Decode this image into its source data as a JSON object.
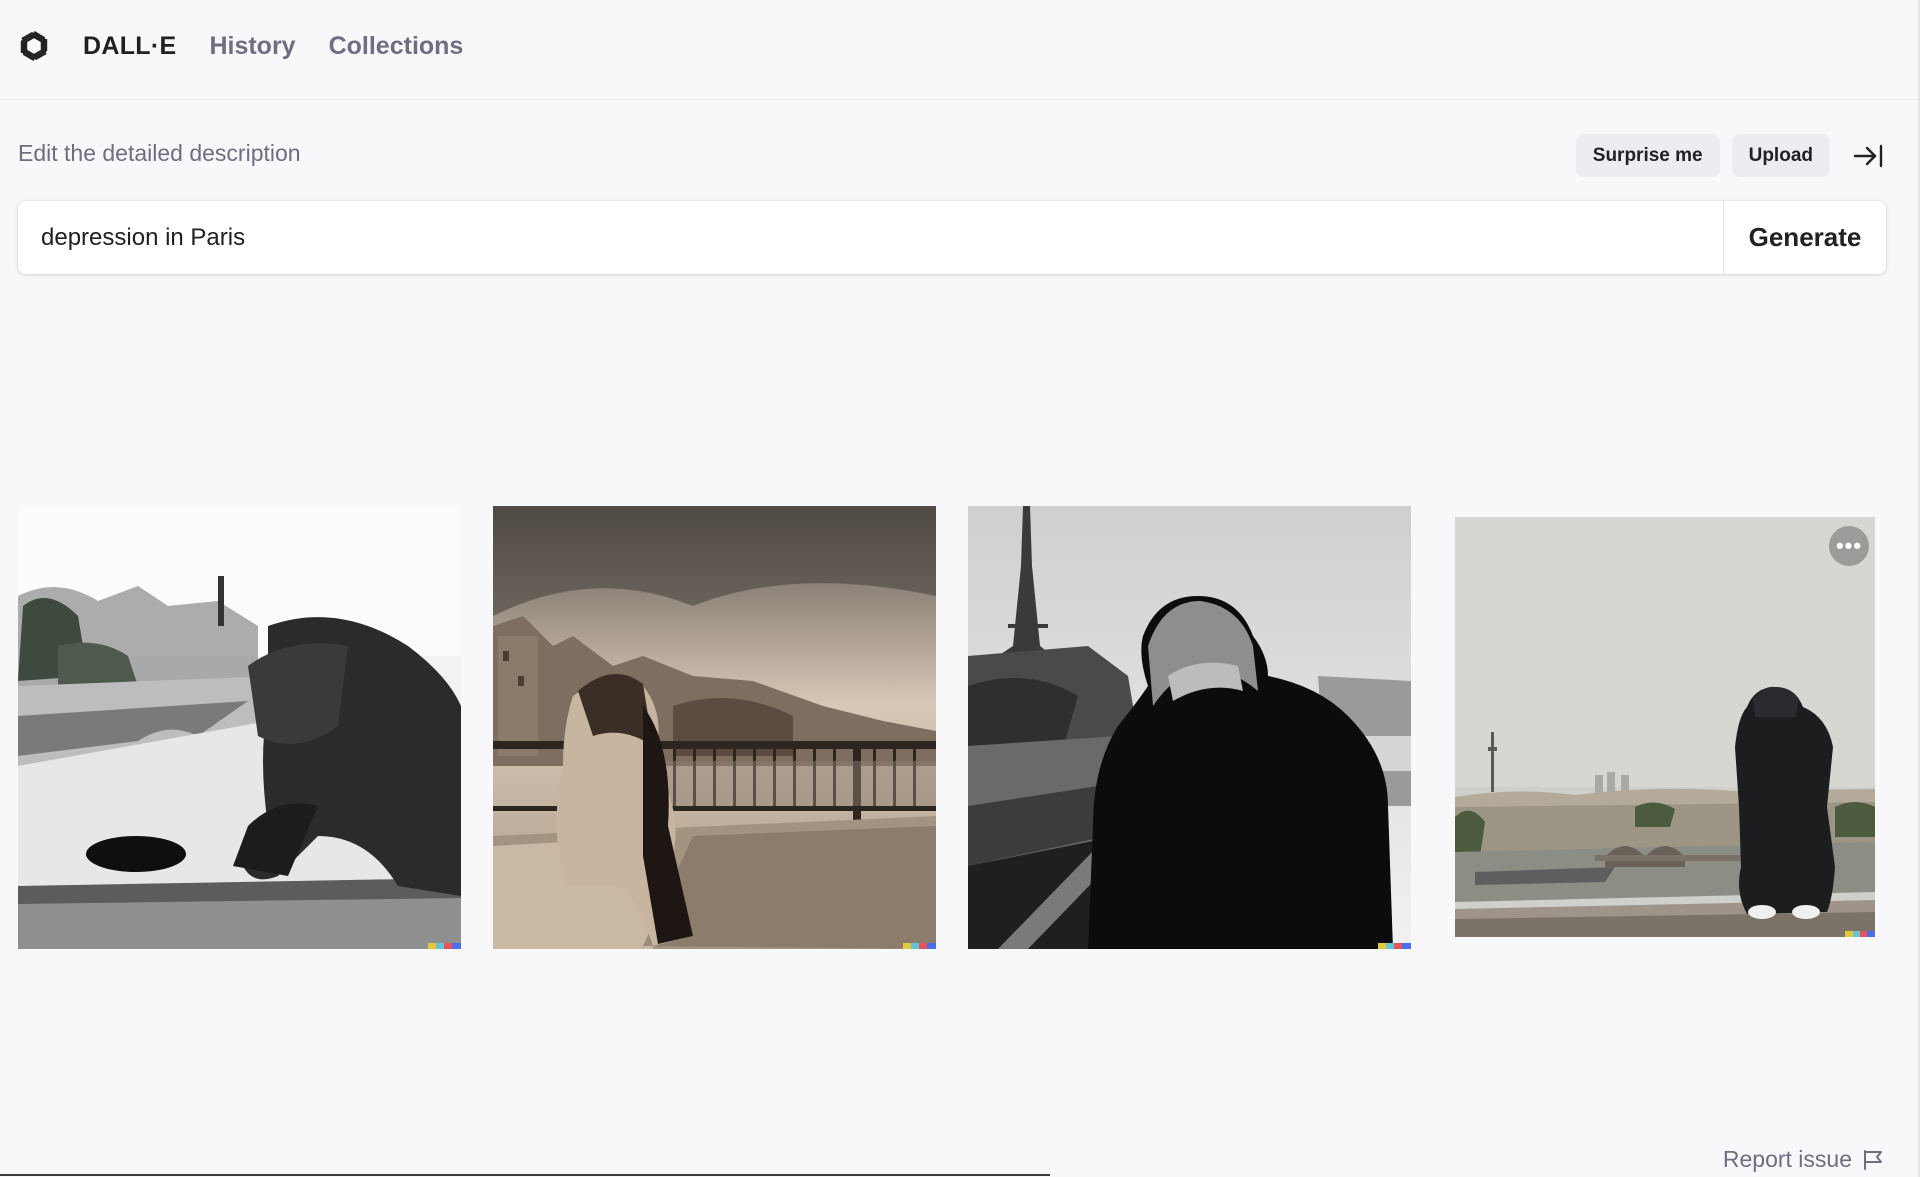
{
  "header": {
    "brand": "DALL·E",
    "nav": [
      {
        "label": "History"
      },
      {
        "label": "Collections"
      }
    ]
  },
  "prompt": {
    "instructions": "Edit the detailed description",
    "surprise_label": "Surprise me",
    "upload_label": "Upload",
    "value": "depression in Paris",
    "generate_label": "Generate"
  },
  "results": {
    "images": [
      {
        "icon": "hooded-figure-by-seine-bw-image"
      },
      {
        "icon": "woman-at-bridge-railing-sepia-image"
      },
      {
        "icon": "hooded-figure-with-eiffel-tower-bw-image"
      },
      {
        "icon": "hooded-figure-over-paris-skyline-image"
      }
    ],
    "more_icon": "ellipsis-icon"
  },
  "footer": {
    "report_label": "Report issue",
    "report_icon": "flag-icon"
  },
  "colors": {
    "background": "#f8f8fb",
    "pill": "#ececf1",
    "text_primary": "#202123",
    "text_secondary": "#6e6e80"
  }
}
